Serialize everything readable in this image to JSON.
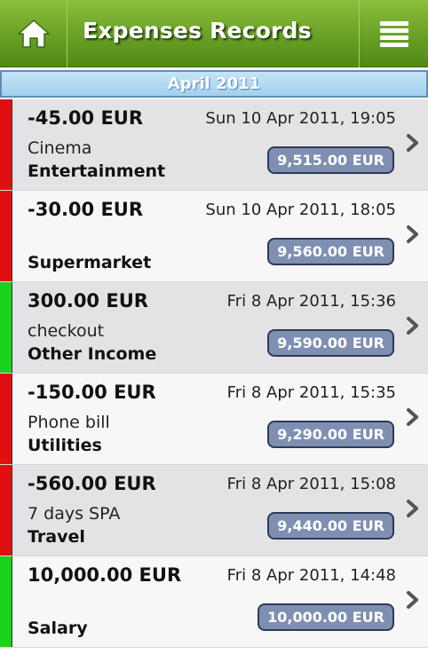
{
  "header": {
    "title": "Expenses Records",
    "home_icon": "home-icon",
    "menu_icon": "list-menu-icon"
  },
  "month": "April 2011",
  "colors": {
    "expense": "#e01010",
    "income": "#1bd11b",
    "header_green": "#6fa52a",
    "balance_badge": "#7f8fb2"
  },
  "records": [
    {
      "amount": "-45.00 EUR",
      "datetime": "Sun 10 Apr 2011, 19:05",
      "note": "Cinema",
      "category": "Entertainment",
      "balance": "9,515.00 EUR",
      "type": "expense"
    },
    {
      "amount": "-30.00 EUR",
      "datetime": "Sun 10 Apr 2011, 18:05",
      "note": "",
      "category": "Supermarket",
      "balance": "9,560.00 EUR",
      "type": "expense"
    },
    {
      "amount": "300.00 EUR",
      "datetime": "Fri 8 Apr 2011, 15:36",
      "note": "checkout",
      "category": "Other Income",
      "balance": "9,590.00 EUR",
      "type": "income"
    },
    {
      "amount": "-150.00 EUR",
      "datetime": "Fri 8 Apr 2011, 15:35",
      "note": "Phone bill",
      "category": "Utilities",
      "balance": "9,290.00 EUR",
      "type": "expense"
    },
    {
      "amount": "-560.00 EUR",
      "datetime": "Fri 8 Apr 2011, 15:08",
      "note": "7 days SPA",
      "category": "Travel",
      "balance": "9,440.00 EUR",
      "type": "expense"
    },
    {
      "amount": "10,000.00 EUR",
      "datetime": "Fri 8 Apr 2011, 14:48",
      "note": "",
      "category": "Salary",
      "balance": "10,000.00 EUR",
      "type": "income"
    }
  ]
}
